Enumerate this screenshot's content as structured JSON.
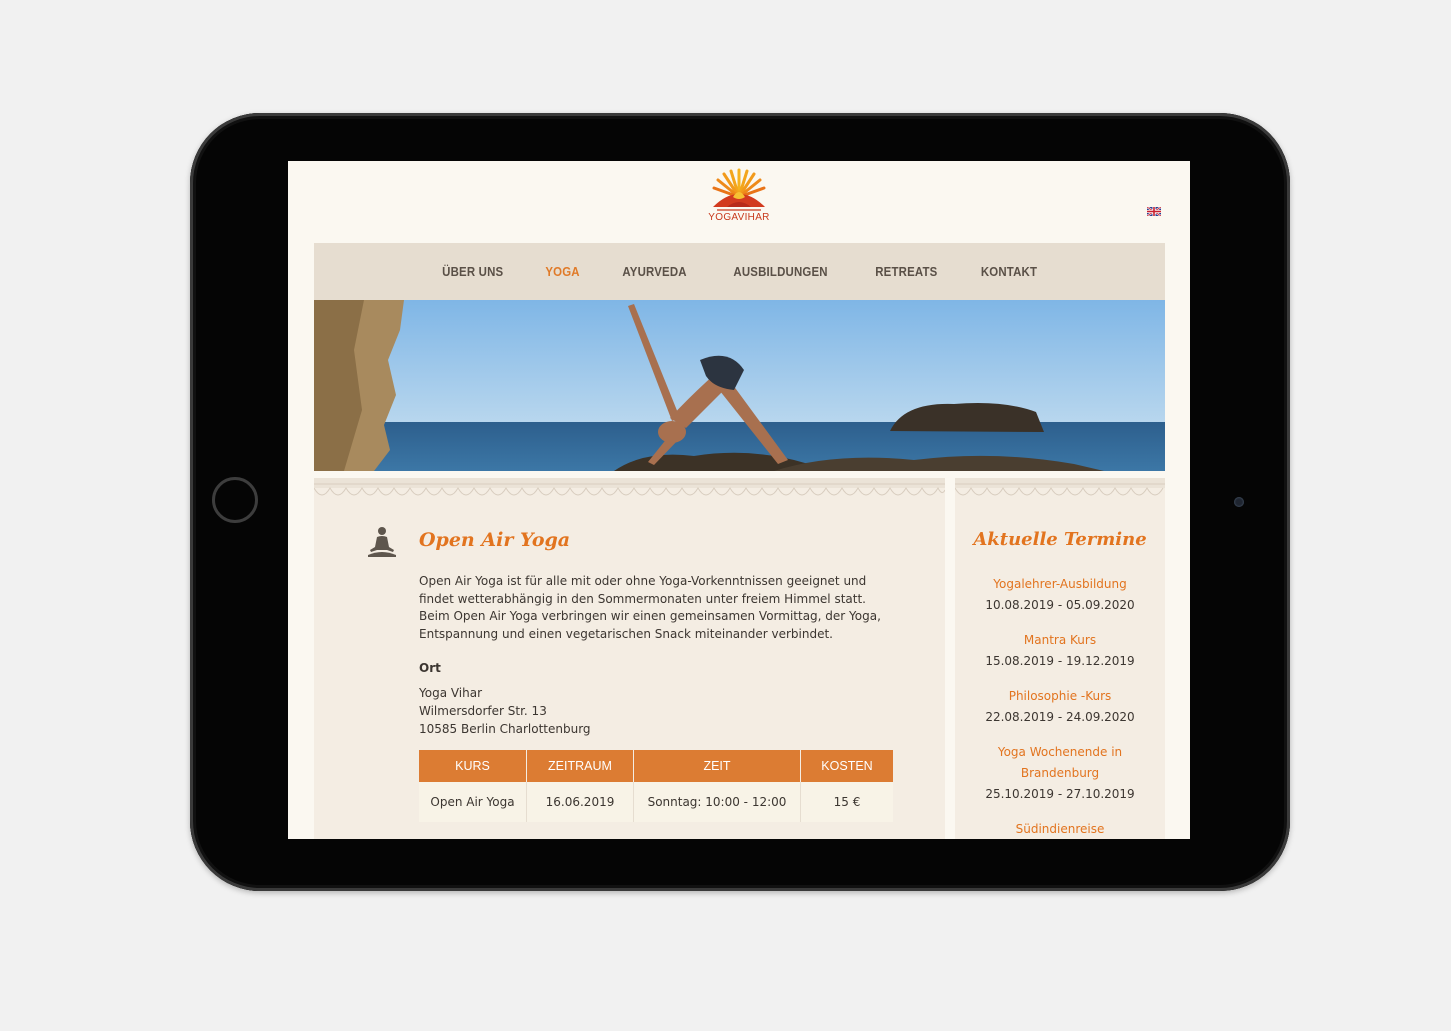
{
  "site": {
    "logo_text": "YOGAVIHAR",
    "language_flag": "uk-flag-icon"
  },
  "nav": {
    "items": [
      {
        "label": "ÜBER UNS",
        "active": false
      },
      {
        "label": "YOGA",
        "active": true
      },
      {
        "label": "AYURVEDA",
        "active": false
      },
      {
        "label": "AUSBILDUNGEN",
        "active": false
      },
      {
        "label": "RETREATS",
        "active": false
      },
      {
        "label": "KONTAKT",
        "active": false
      }
    ]
  },
  "content": {
    "icon": "meditation-icon",
    "title": "Open Air Yoga",
    "intro": "Open Air Yoga ist für alle mit oder ohne Yoga-Vorkenntnissen geeignet und findet wetterabhängig in den Sommermonaten unter freiem Himmel statt. Beim Open Air Yoga verbringen wir einen gemeinsamen Vormittag, der Yoga, Entspannung und einen vegetarischen Snack miteinander verbindet.",
    "place_label": "Ort",
    "address": [
      "Yoga Vihar",
      "Wilmersdorfer Str. 13",
      "10585 Berlin Charlottenburg"
    ],
    "table": {
      "headers": [
        "KURS",
        "ZEITRAUM",
        "ZEIT",
        "KOSTEN"
      ],
      "rows": [
        [
          "Open Air Yoga",
          "16.06.2019",
          "Sonntag: 10:00 - 12:00",
          "15 €"
        ]
      ]
    }
  },
  "sidebar": {
    "title": "Aktuelle Termine",
    "events": [
      {
        "name": "Yogalehrer-Ausbildung",
        "date": "10.08.2019 - 05.09.2020"
      },
      {
        "name": "Mantra Kurs",
        "date": "15.08.2019 - 19.12.2019"
      },
      {
        "name": "Philosophie -Kurs",
        "date": "22.08.2019 - 24.09.2020"
      },
      {
        "name": "Yoga Wochenende in Brandenburg",
        "date": "25.10.2019 - 27.10.2019"
      },
      {
        "name": "Südindienreise",
        "date": ""
      }
    ]
  },
  "colors": {
    "accent": "#e2741f",
    "nav_bg": "#e6ddd0",
    "table_header": "#dc7c33",
    "page_bg": "#fbf8f1",
    "content_bg": "#f4ede3"
  }
}
